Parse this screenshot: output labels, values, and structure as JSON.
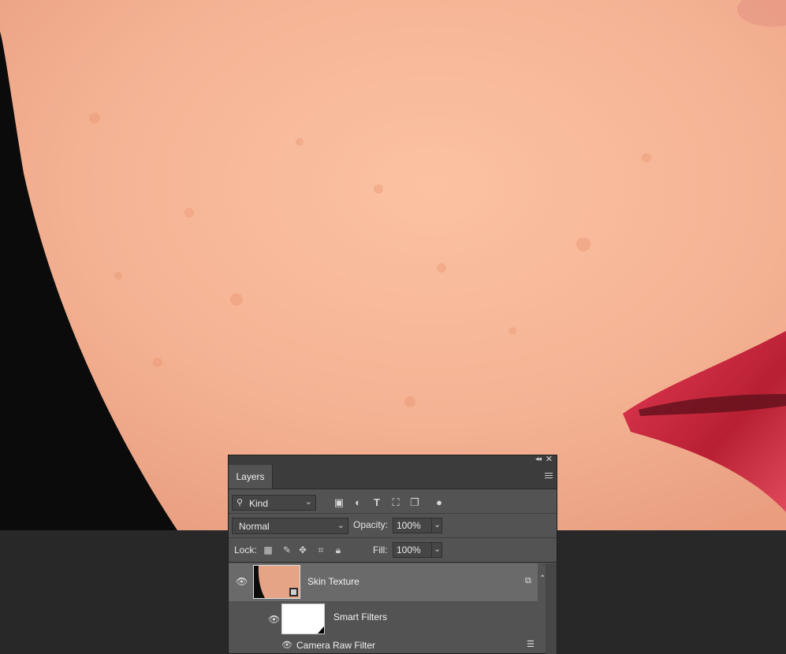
{
  "panel": {
    "tab_label": "Layers",
    "filter": {
      "kind_label": "Kind"
    },
    "blend_mode": "Normal",
    "opacity_label": "Opacity:",
    "opacity_value": "100%",
    "lock_label": "Lock:",
    "fill_label": "Fill:",
    "fill_value": "100%",
    "layers": [
      {
        "name": "Skin Texture",
        "visible": true,
        "selected": true
      }
    ],
    "smart_filters_label": "Smart Filters",
    "filter_item_label": "Camera Raw Filter"
  },
  "colors": {
    "skin": "#f6b896",
    "lip": "#c8283c",
    "panel_bg": "#535353",
    "selected_row": "#6a6a6a"
  }
}
